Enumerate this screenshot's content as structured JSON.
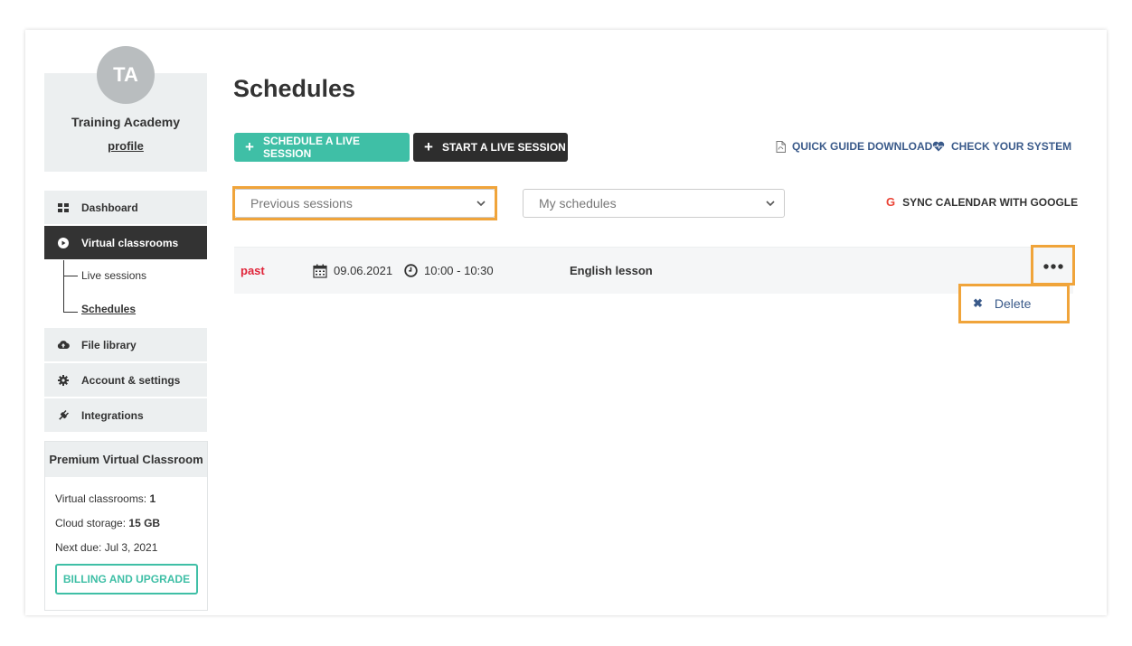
{
  "profile": {
    "initials": "TA",
    "name": "Training Academy",
    "link": "profile"
  },
  "sidebar": {
    "items": [
      {
        "label": "Dashboard",
        "icon": "dashboard-icon"
      },
      {
        "label": "Virtual classrooms",
        "icon": "play-circle-icon"
      },
      {
        "label": "File library",
        "icon": "cloud-upload-icon"
      },
      {
        "label": "Account & settings",
        "icon": "gear-icon"
      },
      {
        "label": "Integrations",
        "icon": "plug-icon"
      }
    ],
    "sub_items": [
      {
        "label": "Live sessions"
      },
      {
        "label": "Schedules"
      }
    ]
  },
  "plan": {
    "title": "Premium Virtual Classroom",
    "classrooms_label": "Virtual classrooms: ",
    "classrooms_value": "1",
    "storage_label": "Cloud storage: ",
    "storage_value": "15 GB",
    "next_due": "Next due: Jul 3, 2021",
    "billing_button": "BILLING AND UPGRADE"
  },
  "main": {
    "title": "Schedules",
    "schedule_button": "SCHEDULE A LIVE SESSION",
    "start_button": "START A LIVE SESSION",
    "guide_link": "QUICK GUIDE DOWNLOAD",
    "check_link": "CHECK YOUR SYSTEM",
    "filter_select": "Previous sessions",
    "owner_select": "My schedules",
    "sync_link": "SYNC CALENDAR WITH GOOGLE",
    "sync_icon_letter": "G"
  },
  "sessions": [
    {
      "status": "past",
      "date": "09.06.2021",
      "time": "10:00 - 10:30",
      "title": "English lesson"
    }
  ],
  "row_menu": {
    "delete_label": "Delete"
  },
  "colors": {
    "accent": "#3fbfa6",
    "dark": "#2d2d2d",
    "highlight": "#f0a43a",
    "past": "#e0253a",
    "link": "#3a5a8a"
  }
}
